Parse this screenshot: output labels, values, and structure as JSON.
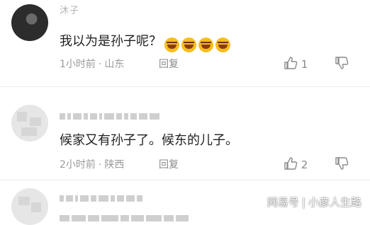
{
  "comments": [
    {
      "username": "沐子",
      "content": "我以为是孙子呢？",
      "emoji_count": 4,
      "emoji_icon": "laughing-tears-emoji",
      "time": "1小时前",
      "location": "山东",
      "reply_label": "回复",
      "likes": "1"
    },
    {
      "username": "",
      "content": "候家又有孙子了。候东的儿子。",
      "time": "2小时前",
      "location": "陕西",
      "reply_label": "回复",
      "likes": "2"
    }
  ],
  "meta_separator": "·",
  "watermark": {
    "brand": "网易号",
    "divider": "|",
    "author": "小彦人生路"
  },
  "colors": {
    "meta_text": "#9a9a9a",
    "content_text": "#1f1f1f",
    "emoji_yellow": "#f6bd1e"
  }
}
